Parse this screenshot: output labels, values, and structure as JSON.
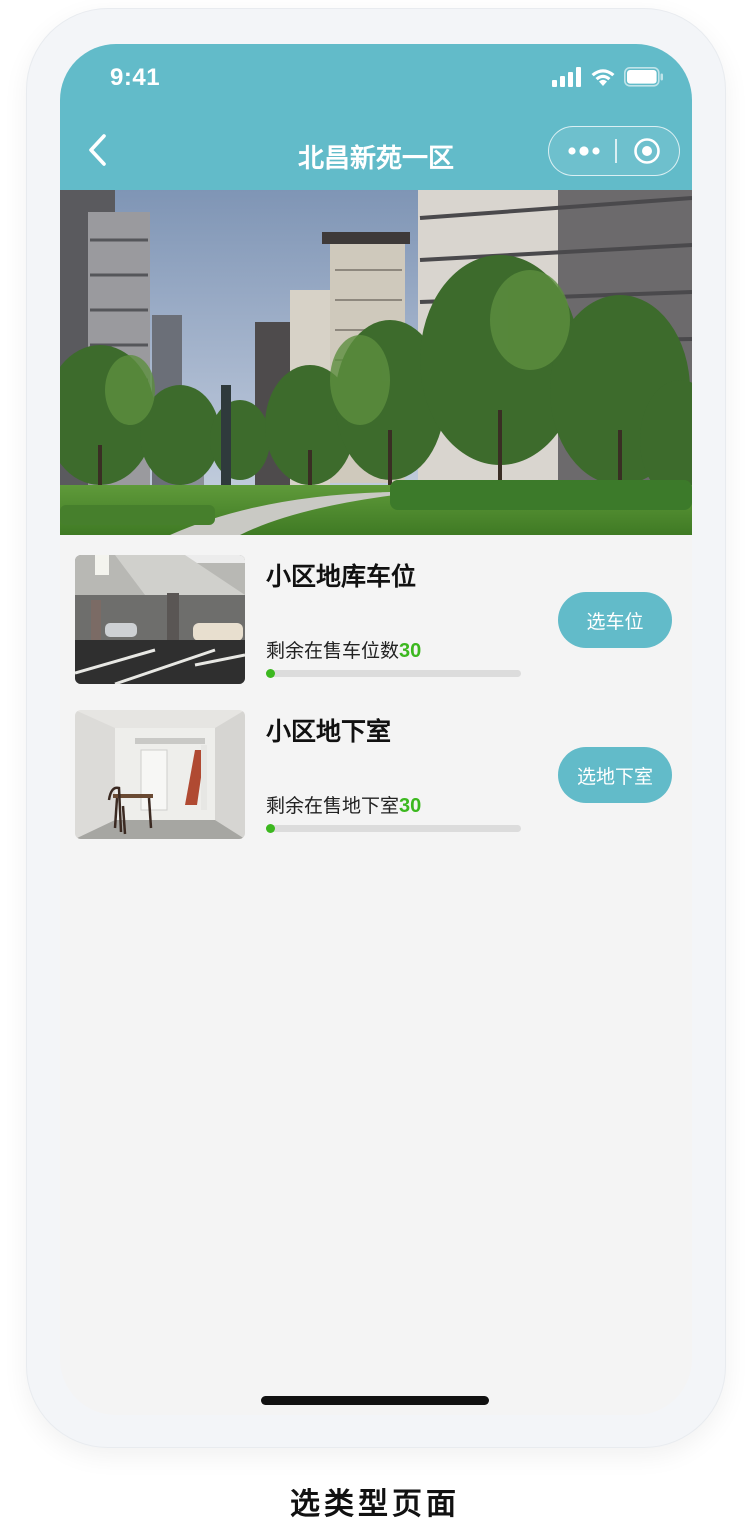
{
  "status_bar": {
    "time": "9:41"
  },
  "nav": {
    "title": "北昌新苑一区"
  },
  "colors": {
    "brand": "#62bbc9",
    "accent_green": "#3cb81f",
    "page_bg": "#f4f4f4"
  },
  "icons": [
    "back-chevron-icon",
    "signal-icon",
    "wifi-icon",
    "battery-icon",
    "more-dots-icon",
    "close-target-icon"
  ],
  "banner": {
    "image": "residential-complex-photo"
  },
  "items": [
    {
      "title": "小区地库车位",
      "remaining_label": "剩余在售车位数",
      "remaining_count": "30",
      "progress_fraction": 0.03,
      "button_label": "选车位",
      "thumbnail": "underground-parking-photo"
    },
    {
      "title": "小区地下室",
      "remaining_label": "剩余在售地下室",
      "remaining_count": "30",
      "progress_fraction": 0.03,
      "button_label": "选地下室",
      "thumbnail": "basement-room-photo"
    }
  ],
  "caption": "选类型页面"
}
